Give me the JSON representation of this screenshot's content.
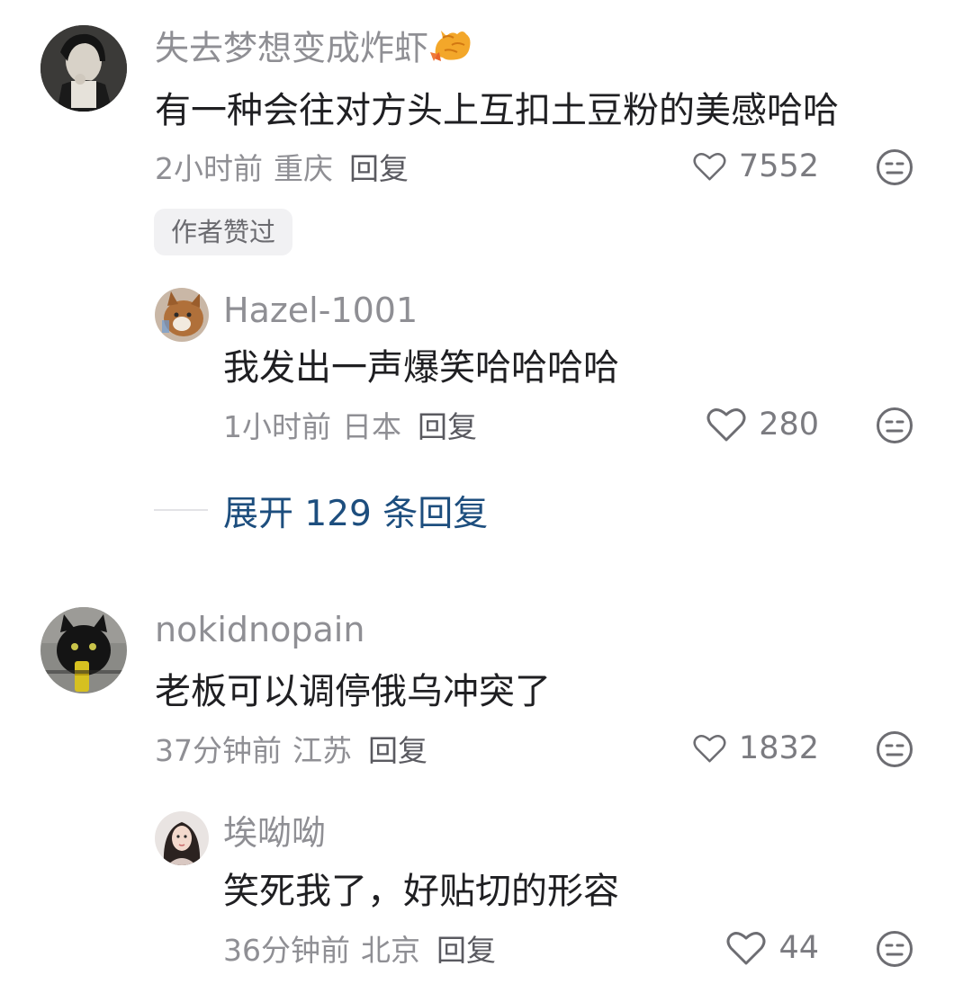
{
  "comments": [
    {
      "username": "失去梦想变成炸虾",
      "emoji": "fried-shrimp-emoji",
      "text": "有一种会往对方头上互扣土豆粉的美感哈哈",
      "time": "2小时前",
      "location": "重庆",
      "reply_label": "回复",
      "likes": "7552",
      "badge": "作者赞过",
      "replies": [
        {
          "username": "Hazel-1001",
          "text": "我发出一声爆笑哈哈哈哈",
          "time": "1小时前",
          "location": "日本",
          "reply_label": "回复",
          "likes": "280"
        }
      ],
      "expand_label": "展开 129 条回复"
    },
    {
      "username": "nokidnopain",
      "text": "老板可以调停俄乌冲突了",
      "time": "37分钟前",
      "location": "江苏",
      "reply_label": "回复",
      "likes": "1832",
      "replies": [
        {
          "username": "埃呦呦",
          "text": "笑死我了，好贴切的形容",
          "time": "36分钟前",
          "location": "北京",
          "reply_label": "回复",
          "likes": "44"
        }
      ]
    }
  ],
  "colors": {
    "username": "#8f8f94",
    "body": "#1f1f22",
    "link": "#1d4e7e",
    "badge_bg": "#f1f1f3"
  }
}
